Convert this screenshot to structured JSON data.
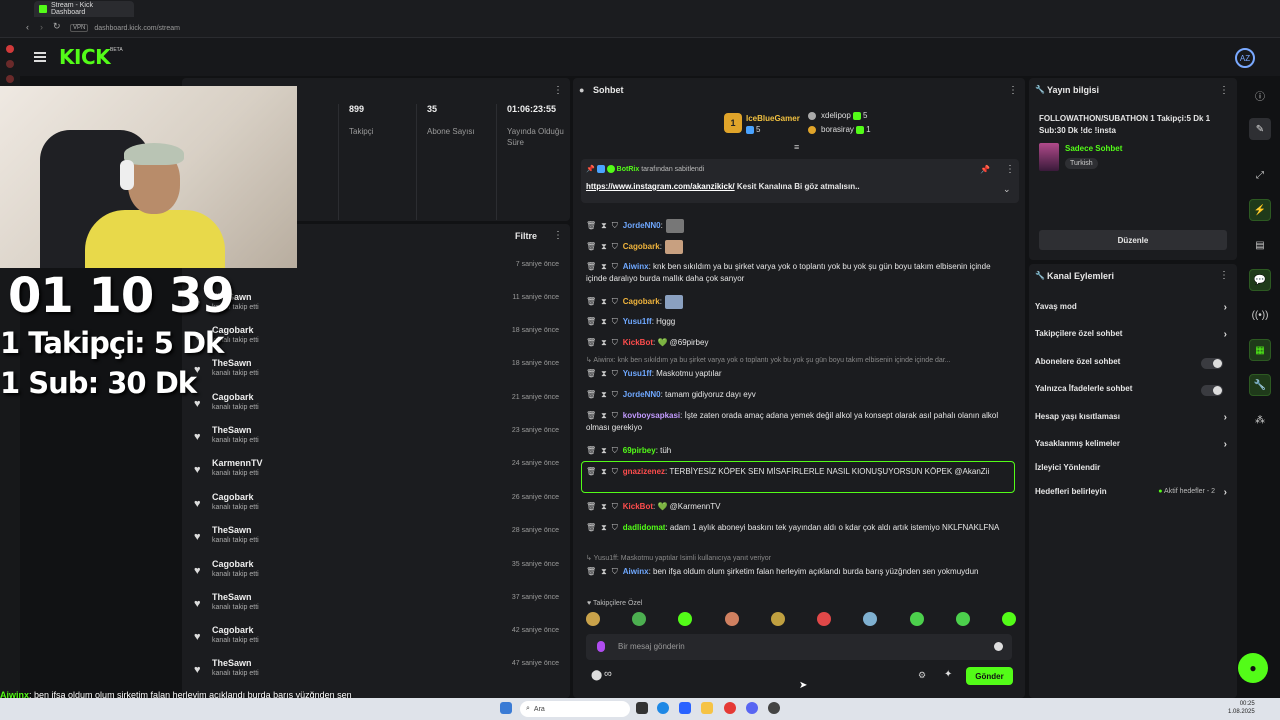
{
  "browser": {
    "tab_title": "Stream - Kick Dashboard",
    "url": "dashboard.kick.com/stream",
    "vpn": "VPN"
  },
  "header": {
    "logo": "KICK",
    "beta": "BETA",
    "avatar": "AZ"
  },
  "stats": {
    "items": [
      {
        "value": "899",
        "label": "Takipçi"
      },
      {
        "value": "35",
        "label": "Abone Sayısı"
      },
      {
        "value": "01:06:23:55",
        "label": "Yayında Olduğu Süre"
      }
    ]
  },
  "followers": {
    "filter_label": "Filtre",
    "action": "kanalı takip etti",
    "rows": [
      {
        "name": "",
        "time": "7 saniye önce"
      },
      {
        "name": "TheSawn",
        "time": "11 saniye önce"
      },
      {
        "name": "Cagobark",
        "time": "18 saniye önce"
      },
      {
        "name": "TheSawn",
        "time": "18 saniye önce"
      },
      {
        "name": "Cagobark",
        "time": "21 saniye önce"
      },
      {
        "name": "TheSawn",
        "time": "23 saniye önce"
      },
      {
        "name": "KarmennTV",
        "time": "24 saniye önce"
      },
      {
        "name": "Cagobark",
        "time": "26 saniye önce"
      },
      {
        "name": "TheSawn",
        "time": "28 saniye önce"
      },
      {
        "name": "Cagobark",
        "time": "35 saniye önce"
      },
      {
        "name": "TheSawn",
        "time": "37 saniye önce"
      },
      {
        "name": "Cagobark",
        "time": "42 saniye önce"
      },
      {
        "name": "TheSawn",
        "time": "47 saniye önce"
      }
    ]
  },
  "overlay": {
    "timer": "01 10 39",
    "line1": "1 Takipçi: 5 Dk",
    "line2": "1 Sub: 30 Dk",
    "chat_user": "Aiwinx",
    "chat_text": ": ben ifşa oldum olum şirketim falan herleyim açıklandı burda barış yüzğnden sen yokmuydun"
  },
  "chat": {
    "title": "Sohbet",
    "top_gifters": [
      {
        "rank": "1",
        "name": "IceBlueGamer",
        "count": "5"
      },
      {
        "name": "xdelipop",
        "count": "5"
      },
      {
        "name": "borasiray",
        "count": "1"
      }
    ],
    "pinned": {
      "by_user": "BotRix",
      "by_text": "tarafından sabitlendi",
      "link": "https://www.instagram.com/akanzikick/",
      "text": " Kesit Kanalına Bi göz atmalısın.."
    },
    "messages": [
      {
        "user": "JordeNN0",
        "text": ":",
        "color": "#6fa8ff"
      },
      {
        "user": "Cagobark",
        "text": ":",
        "color": "#f0b43c"
      },
      {
        "user": "Aiwinx",
        "text": ": knk ben sıkıldım ya bu şirket varya yok o toplantı yok bu yok şu gün boyu takım elbisenin içinde içinde daralıyo burda mallık daha çok sanyor",
        "color": "#6fa8ff"
      },
      {
        "user": "Cagobark",
        "text": ":",
        "color": "#f0b43c"
      },
      {
        "user": "Yusu1ff",
        "text": ": Hggg",
        "color": "#6fa8ff"
      },
      {
        "user": "KickBot",
        "text": ": 💚 @69pirbey",
        "color": "#ff4d4d"
      },
      {
        "user": "Yusu1ff",
        "text": ": Maskotmu yaptılar",
        "color": "#6fa8ff"
      },
      {
        "user": "JordeNN0",
        "text": ": tamam gidiyoruz dayı eyv",
        "color": "#6fa8ff"
      },
      {
        "user": "kovboysapkasi",
        "text": ": İşte zaten orada amaç adana yemek değil alkol ya konsept olarak asıl pahalı olanın alkol olması gerekiyo",
        "color": "#c39bff"
      },
      {
        "user": "69pirbey",
        "text": ": tüh",
        "color": "#53fc18"
      },
      {
        "user": "gnazizenez",
        "text": ": TERBİYESİZ KÖPEK SEN MİSAFİRLERLE NASIL KIONUŞUYORSUN KÖPEK @AkanZii",
        "color": "#ff4d4d"
      },
      {
        "user": "KickBot",
        "text": ": 💚 @KarmennTV",
        "color": "#ff4d4d"
      },
      {
        "user": "dadlidomat",
        "text": ": adam 1 aylık aboneyi baskını tek yayından aldı o kdar çok aldı artık istemiyo NKLFNAKLFNA",
        "color": "#53fc18"
      },
      {
        "user": "Aiwinx",
        "text": ": ben ifşa oldum olum şirketim falan herleyim açıklandı burda barış yüzğnden sen yokmuydun",
        "color": "#6fa8ff"
      }
    ],
    "reply1": "↳ Aiwinx: knk ben sıkıldım ya bu şirket varya yok o toplantı yok bu yok şu gün boyu takım elbisenin içinde içinde dar...",
    "reply2": "↳ Yusu1ff: Maskotmu yaptılar  İsimli kullanıcıya yanıt veriyor",
    "followers_only": "♥ Takipçilere Özel",
    "input_placeholder": "Bir mesaj gönderin",
    "infinity": "∞",
    "send_label": "Gönder"
  },
  "info": {
    "title": "Yayın bilgisi",
    "stream_title": "FOLLOWATHON/SUBATHON 1 Takipçi:5 Dk 1 Sub:30 Dk !dc !insta",
    "category": "Sadece Sohbet",
    "language": "Turkish",
    "edit_label": "Düzenle"
  },
  "actions": {
    "title": "Kanal Eylemleri",
    "items": [
      {
        "label": "Yavaş mod",
        "type": "chevron"
      },
      {
        "label": "Takipçilere özel sohbet",
        "type": "chevron"
      },
      {
        "label": "Abonelere özel sohbet",
        "type": "toggle"
      },
      {
        "label": "Yalnızca İfadelerle sohbet",
        "type": "toggle"
      },
      {
        "label": "Hesap yaşı kısıtlaması",
        "type": "chevron"
      },
      {
        "label": "Yasaklanmış kelimeler",
        "type": "chevron"
      },
      {
        "label": "İzleyici Yönlendir",
        "type": "none"
      },
      {
        "label": "Hedefleri belirleyin",
        "type": "chevron",
        "extra": "Aktif hedefler - 2"
      }
    ]
  },
  "taskbar": {
    "search": "Ara",
    "time": "00:25",
    "date": "1.08.2025"
  },
  "colors": {
    "accent": "#53fc18",
    "bg": "#111214",
    "panel": "#1b1c1f"
  }
}
